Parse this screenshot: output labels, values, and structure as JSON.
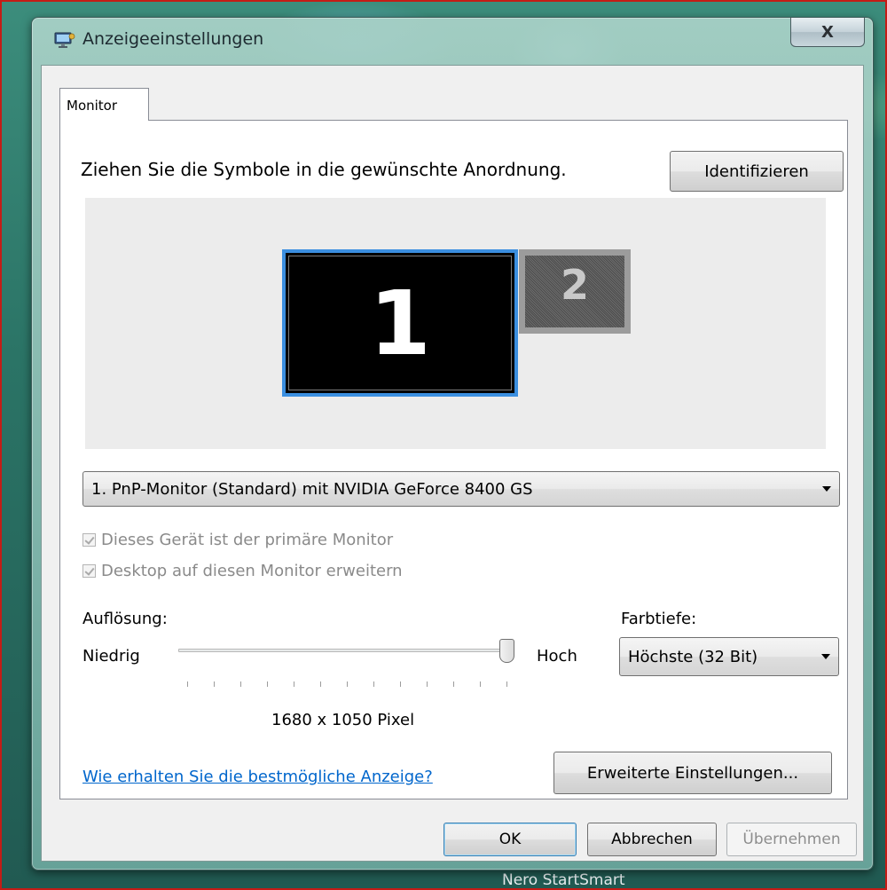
{
  "window": {
    "title": "Anzeigeeinstellungen",
    "close_glyph": "X",
    "app_icon": "display-settings-icon"
  },
  "tabs": [
    {
      "label": "Monitor",
      "selected": true
    }
  ],
  "arrange": {
    "instruction": "Ziehen Sie die Symbole in die gewünschte Anordnung.",
    "identify_label": "Identifizieren",
    "monitors": [
      {
        "number": "1",
        "selected": true
      },
      {
        "number": "2",
        "selected": false
      }
    ]
  },
  "display_select": {
    "value": "1. PnP-Monitor (Standard) mit NVIDIA GeForce 8400 GS"
  },
  "checkboxes": {
    "primary": {
      "label": "Dieses Gerät ist der primäre Monitor",
      "checked": true,
      "disabled": true
    },
    "extend": {
      "label": "Desktop auf diesen Monitor erweitern",
      "checked": true,
      "disabled": true
    }
  },
  "resolution": {
    "label": "Auflösung:",
    "low_label": "Niedrig",
    "high_label": "Hoch",
    "value_text": "1680 x 1050 Pixel",
    "slider_level": 1.0,
    "tick_count": 13
  },
  "color_depth": {
    "label": "Farbtiefe:",
    "value": "Höchste (32 Bit)"
  },
  "help_link": "Wie erhalten Sie die bestmögliche Anzeige?",
  "advanced_label": "Erweiterte Einstellungen...",
  "footer": {
    "ok_label": "OK",
    "cancel_label": "Abbrechen",
    "apply_label": "Übernehmen"
  },
  "taskbar": {
    "text": "Nero StartSmart"
  },
  "colors": {
    "selection_border": "#3b8fe0",
    "link": "#0066cc",
    "highlight_frame": "#c41c16"
  }
}
